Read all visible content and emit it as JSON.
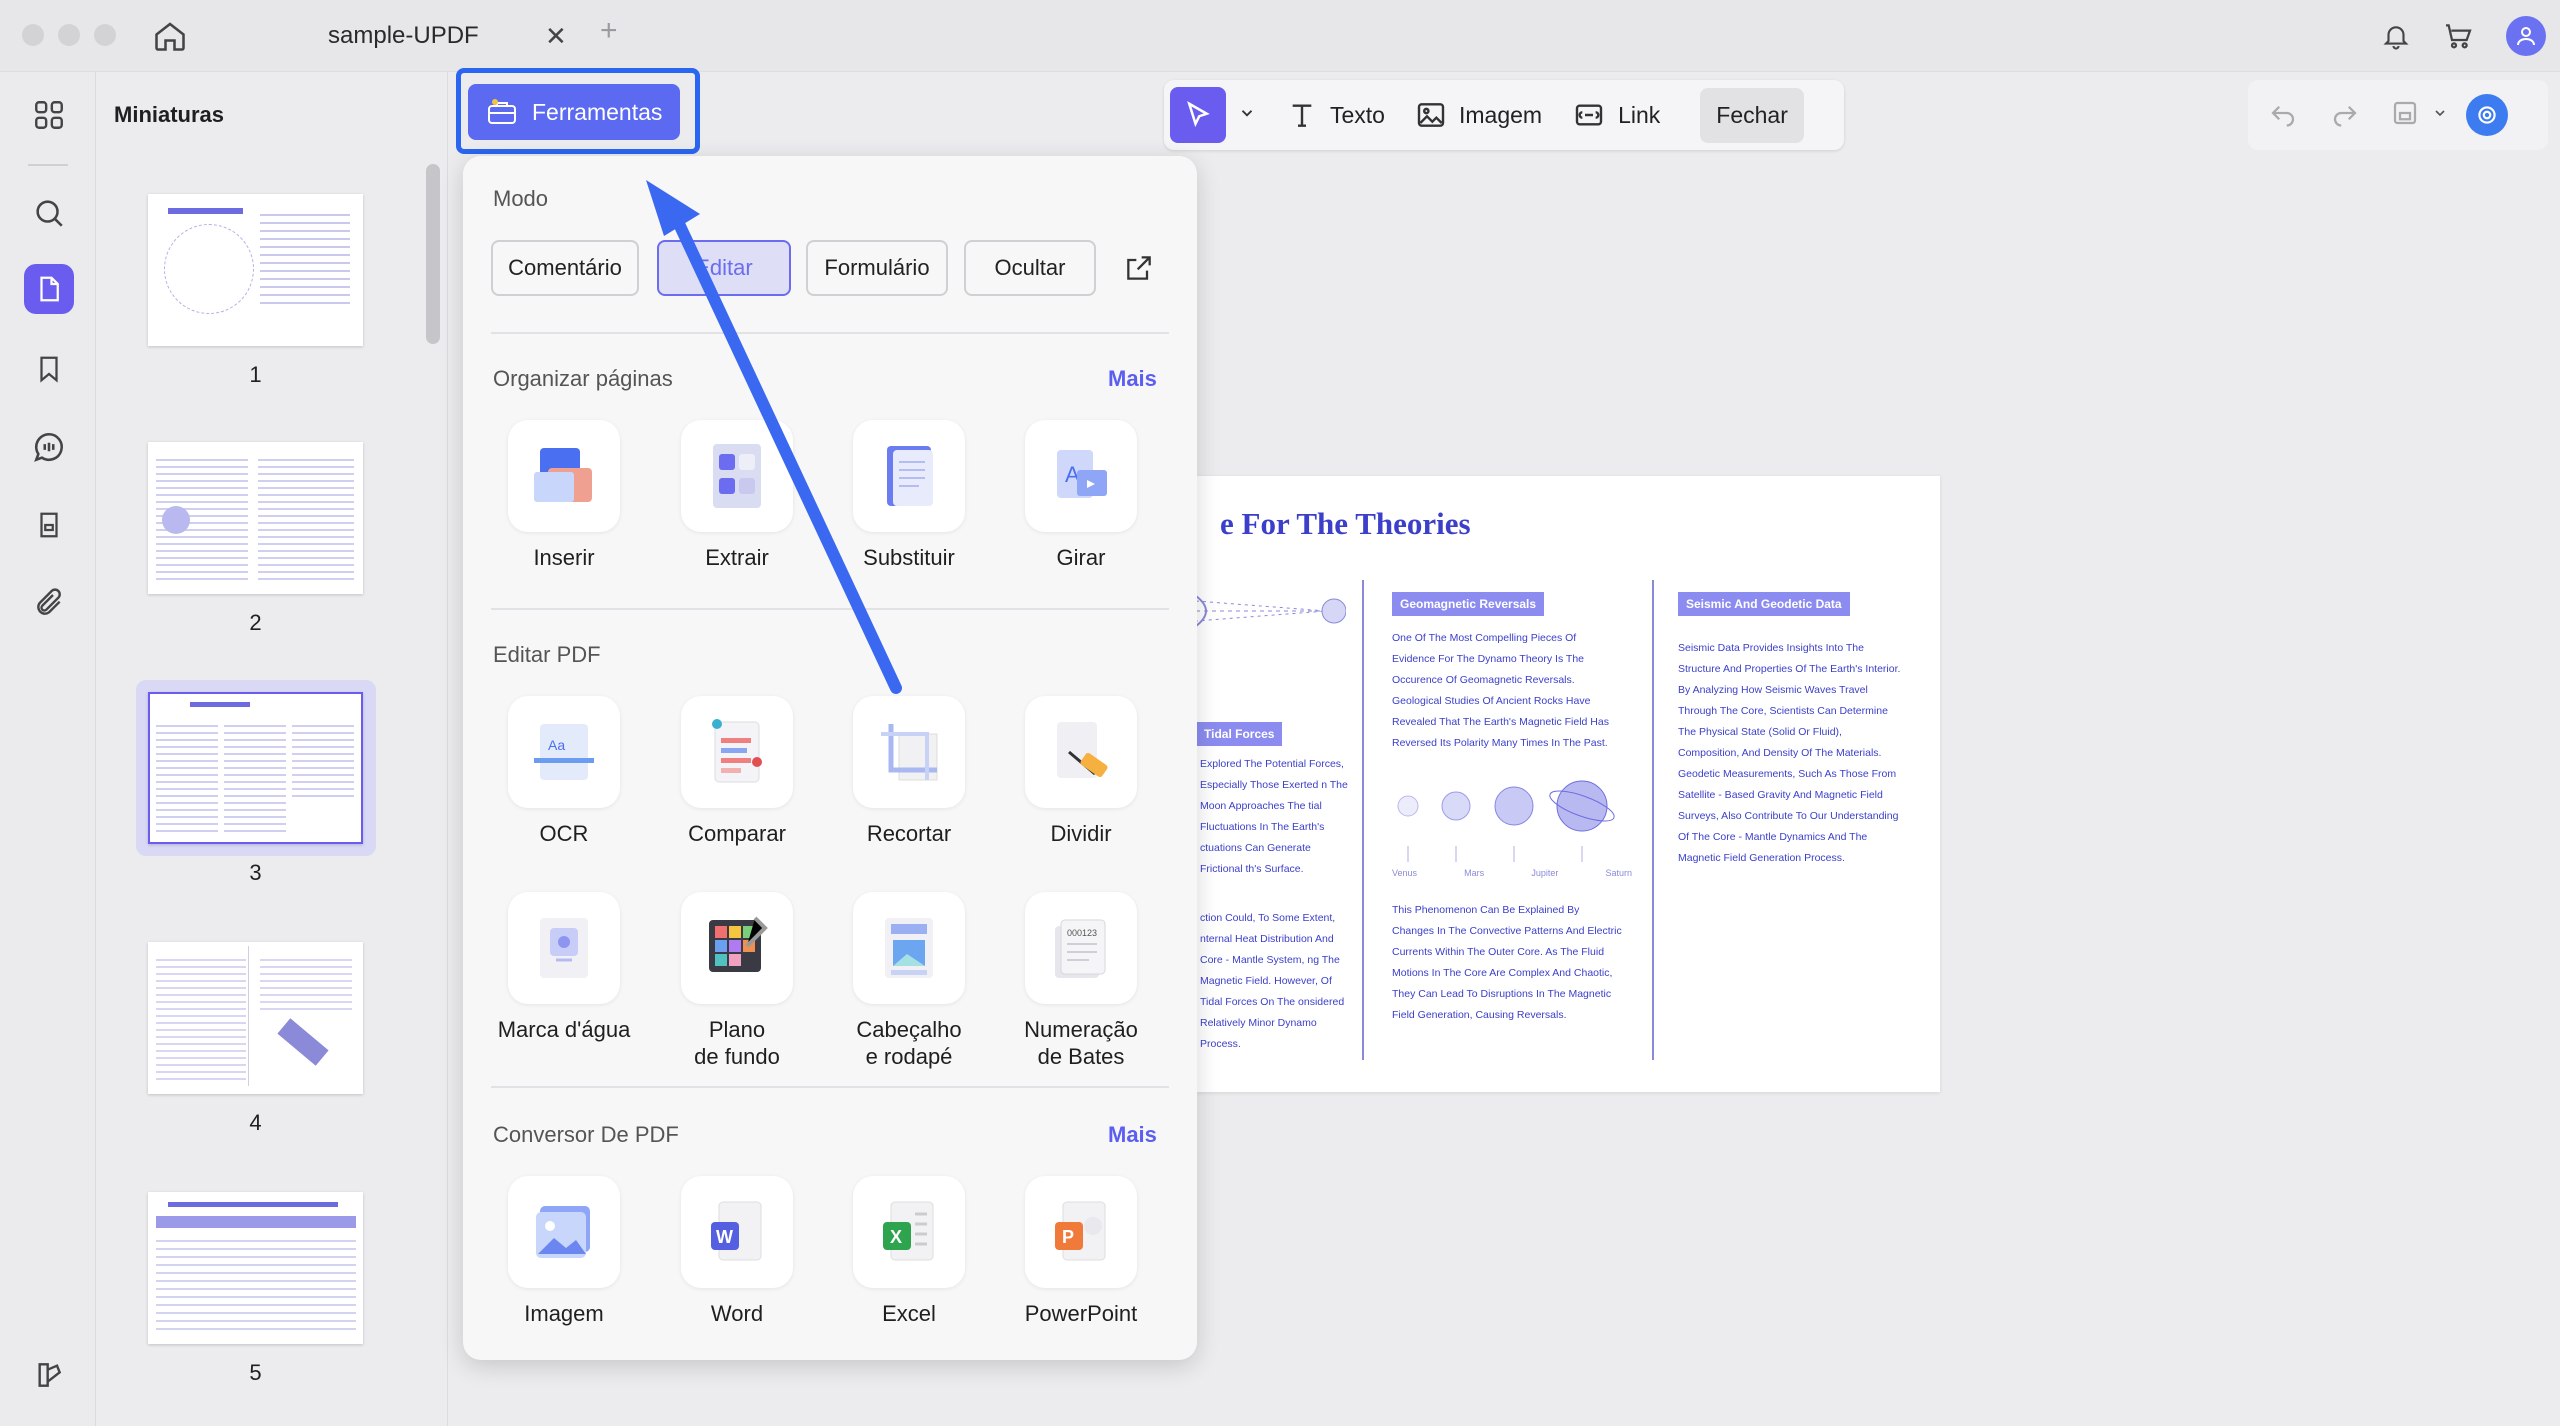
{
  "window": {
    "tab_title": "sample-UPDF",
    "tab_close": "✕",
    "new_tab": "+"
  },
  "thumbnails": {
    "title": "Miniaturas",
    "pages": [
      "1",
      "2",
      "3",
      "4",
      "5"
    ],
    "selected": "3"
  },
  "toolbar": {
    "tools_label": "Ferramentas",
    "text_label": "Texto",
    "image_label": "Imagem",
    "link_label": "Link",
    "close_label": "Fechar"
  },
  "dropdown": {
    "mode_title": "Modo",
    "modes": [
      "Comentário",
      "Editar",
      "Formulário",
      "Ocultar"
    ],
    "organize": {
      "title": "Organizar páginas",
      "more": "Mais",
      "items": [
        "Inserir",
        "Extrair",
        "Substituir",
        "Girar"
      ]
    },
    "edit": {
      "title": "Editar PDF",
      "row1": [
        "OCR",
        "Comparar",
        "Recortar",
        "Dividir"
      ],
      "row2": [
        {
          "l1": "Marca d'água",
          "l2": ""
        },
        {
          "l1": "Plano",
          "l2": "de fundo"
        },
        {
          "l1": "Cabeçalho",
          "l2": "e rodapé"
        },
        {
          "l1": "Numeração",
          "l2": "de Bates"
        }
      ]
    },
    "convert": {
      "title": "Conversor De PDF",
      "more": "Mais",
      "items": [
        "Imagem",
        "Word",
        "Excel",
        "PowerPoint"
      ]
    }
  },
  "pdf": {
    "title": "e For The Theories",
    "tag_tidal": "Tidal Forces",
    "tag_geo": "Geomagnetic Reversals",
    "tag_seismic": "Seismic And Geodetic Data",
    "geo_text": "One Of The Most Compelling Pieces Of Evidence For The Dynamo Theory Is The Occurence Of Geomagnetic Reversals. Geological Studies Of Ancient Rocks Have Revealed That The Earth's Magnetic Field Has Reversed Its Polarity Many Times In The Past.",
    "geo_text2": "This Phenomenon Can Be Explained By Changes In The Convective Patterns And Electric Currents Within The Outer Core. As The Fluid Motions In The Core Are Complex And Chaotic, They Can Lead To Disruptions In The Magnetic Field Generation, Causing Reversals.",
    "seismic_text": "Seismic Data Provides Insights Into The Structure And Properties Of The Earth's Interior. By Analyzing How Seismic Waves Travel Through The Core, Scientists Can Determine The Physical State (Solid Or Fluid), Composition, And Density Of The Materials. Geodetic Measurements, Such As Those From Satellite - Based Gravity And Magnetic Field Surveys, Also Contribute To Our Understanding Of The Core - Mantle Dynamics And The Magnetic Field Generation Process.",
    "tidal_text": "Explored The Potential Forces, Especially Those Exerted n The Moon Approaches The tial Fluctuations In The Earth's ctuations Can Generate Frictional th's Surface.",
    "tidal_text2": "ction Could, To Some Extent, nternal Heat Distribution And Core - Mantle System, ng The Magnetic Field. However, Of Tidal Forces On The onsidered Relatively Minor Dynamo Process.",
    "planets": [
      "Venus",
      "Mars",
      "Jupiter",
      "Saturn"
    ]
  },
  "colors": {
    "accent": "#5b6af0",
    "highlight": "#2a66f0",
    "pdf_blue": "#3b3fc9"
  }
}
